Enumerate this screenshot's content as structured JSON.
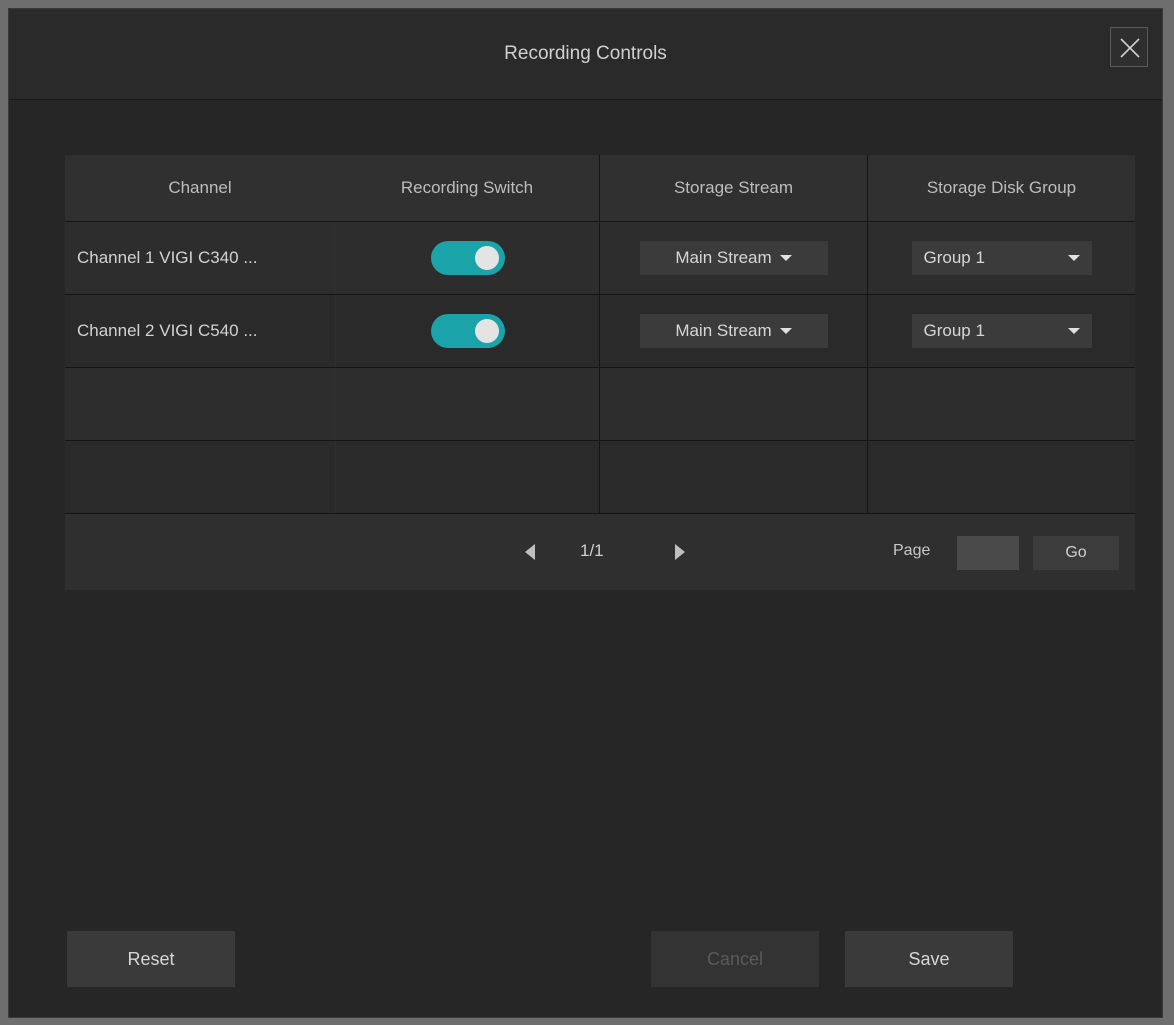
{
  "dialog": {
    "title": "Recording Controls"
  },
  "table": {
    "headers": [
      "Channel",
      "Recording Switch",
      "Storage Stream",
      "Storage Disk Group"
    ],
    "rows": [
      {
        "channel": "Channel 1 VIGI C340 ...",
        "recording_on": true,
        "stream": "Main Stream",
        "group": "Group 1"
      },
      {
        "channel": "Channel 2 VIGI C540 ...",
        "recording_on": true,
        "stream": "Main Stream",
        "group": "Group 1"
      }
    ]
  },
  "pager": {
    "page_display": "1/1",
    "page_label": "Page",
    "page_input_value": "",
    "go_label": "Go"
  },
  "footer": {
    "reset_label": "Reset",
    "cancel_label": "Cancel",
    "save_label": "Save"
  },
  "colors": {
    "toggle_on": "#1aa3a8",
    "background": "#262626"
  }
}
